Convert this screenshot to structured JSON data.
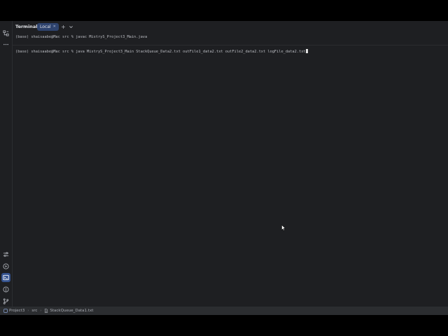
{
  "tool_window": {
    "title": "Terminal",
    "tabs": [
      {
        "label": "Local",
        "active": true
      }
    ],
    "new_tab_label": "+"
  },
  "terminal": {
    "lines": [
      "(base) shaisaabe@Mac src % javac MistryS_Project3_Main.java",
      "(base) shaisaabe@Mac src % java MistryS_Project3_Main StackQueue_Data2.txt outFile1_data2.txt outFile2_data2.txt logFile_data2.txt"
    ]
  },
  "breadcrumb": {
    "items": [
      "Project3",
      "src",
      "StackQueue_Data1.txt"
    ]
  },
  "icons": {
    "top": [
      "structure-icon",
      "more-icon"
    ],
    "bottom": [
      "settings-sliders-icon",
      "run-icon",
      "terminal-icon",
      "problems-icon",
      "git-branch-icon"
    ]
  },
  "colors": {
    "background": "#1e1f22",
    "active_tab": "#2e436e",
    "active_tool": "#35538f",
    "text": "#bcbec4"
  }
}
